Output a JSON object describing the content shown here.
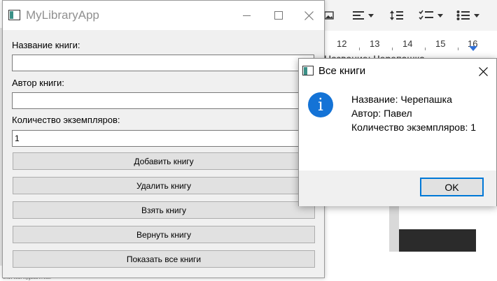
{
  "background_app": {
    "ruler_numbers": [
      "12",
      "13",
      "14",
      "15",
      "16"
    ],
    "doc_text": "Название: Черепашка",
    "status_text": "end.learn@gmail.com"
  },
  "main_window": {
    "title": "MyLibraryApp",
    "controls": {
      "minimize": "—",
      "maximize": "☐",
      "close": "✕"
    },
    "fields": {
      "title_label": "Название книги:",
      "title_value": "",
      "author_label": "Автор книги:",
      "author_value": "",
      "copies_label": "Количество экземпляров:",
      "copies_value": "1"
    },
    "buttons": {
      "add": "Добавить книгу",
      "delete": "Удалить книгу",
      "take": "Взять книгу",
      "return": "Вернуть книгу",
      "show_all": "Показать все книги"
    }
  },
  "message_box": {
    "title": "Все книги",
    "icon": "info-icon",
    "icon_glyph": "i",
    "lines": [
      "Название: Черепашка",
      "Автор: Павел",
      "Количество экземпляров: 1"
    ],
    "ok_label": "OK"
  },
  "colors": {
    "accent": "#0078d7",
    "info_icon": "#1473d6",
    "window_bg": "#f0f0f0",
    "button_bg": "#e1e1e1",
    "title_gray": "#909090"
  }
}
